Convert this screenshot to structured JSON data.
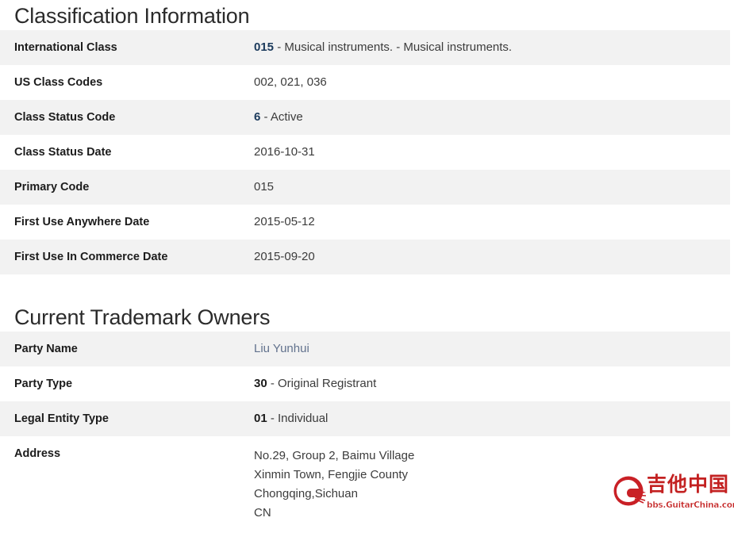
{
  "classification": {
    "heading": "Classification Information",
    "rows": [
      {
        "label": "International Class",
        "code": "015",
        "code_style": "blue",
        "text": " - Musical instruments. - Musical instruments."
      },
      {
        "label": "US Class Codes",
        "code": "",
        "code_style": "none",
        "text": "002, 021, 036"
      },
      {
        "label": "Class Status Code",
        "code": "6",
        "code_style": "blue",
        "text": " - Active"
      },
      {
        "label": "Class Status Date",
        "code": "",
        "code_style": "none",
        "text": "2016-10-31"
      },
      {
        "label": "Primary Code",
        "code": "",
        "code_style": "none",
        "text": "015"
      },
      {
        "label": "First Use Anywhere Date",
        "code": "",
        "code_style": "none",
        "text": "2015-05-12"
      },
      {
        "label": "First Use In Commerce Date",
        "code": "",
        "code_style": "none",
        "text": "2015-09-20"
      }
    ]
  },
  "owners": {
    "heading": "Current Trademark Owners",
    "rows": [
      {
        "label": "Party Name",
        "code": "",
        "code_style": "none",
        "text": "",
        "link": "Liu Yunhui"
      },
      {
        "label": "Party Type",
        "code": "30",
        "code_style": "dark",
        "text": " - Original Registrant"
      },
      {
        "label": "Legal Entity Type",
        "code": "01",
        "code_style": "dark",
        "text": " - Individual"
      },
      {
        "label": "Address",
        "code": "",
        "code_style": "none",
        "address_lines": [
          "No.29, Group 2, Baimu Village",
          "Xinmin Town, Fengjie County",
          "Chongqing,Sichuan",
          "CN"
        ]
      }
    ]
  },
  "watermark": {
    "brand_cn": "吉他中国",
    "url": "bbs.GuitarChina.com",
    "color": "#c21a1a"
  }
}
